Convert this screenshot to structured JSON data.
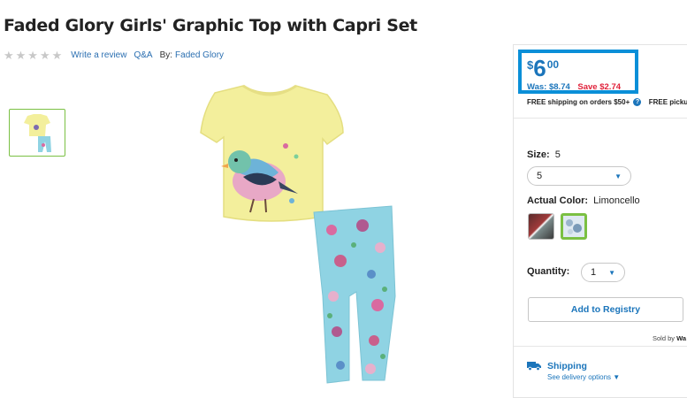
{
  "product": {
    "title": "Faded Glory Girls' Graphic Top with Capri Set",
    "rating_stars": "★★★★★",
    "write_review": "Write a review",
    "qa": "Q&A",
    "by_label": "By:",
    "brand": "Faded Glory"
  },
  "price": {
    "currency": "$",
    "dollars": "6",
    "cents": "00",
    "was": "Was: $8.74",
    "save": "Save $2.74"
  },
  "shipping_note": {
    "free_shipping": "FREE shipping on orders $50+",
    "info_icon_glyph": "?",
    "free_pickup": "FREE pickup"
  },
  "options": {
    "size_label": "Size:",
    "size_value": "5",
    "size_selected": "5",
    "color_label": "Actual Color:",
    "color_value": "Limoncello",
    "quantity_label": "Quantity:",
    "quantity_value": "1",
    "caret_glyph": "▼"
  },
  "actions": {
    "add_to_registry": "Add to Registry"
  },
  "seller": {
    "sold_by": "Sold by",
    "seller_name": "Wa"
  },
  "delivery": {
    "title": "Shipping",
    "link": "See delivery options"
  },
  "colors": {
    "accent_blue": "#1b75bb",
    "price_box_border": "#0a8fd8",
    "save_red": "#e0213a",
    "selected_green": "#7bc043",
    "shirt_yellow": "#f3ef9c",
    "leggings_blue": "#8fd3e3"
  }
}
